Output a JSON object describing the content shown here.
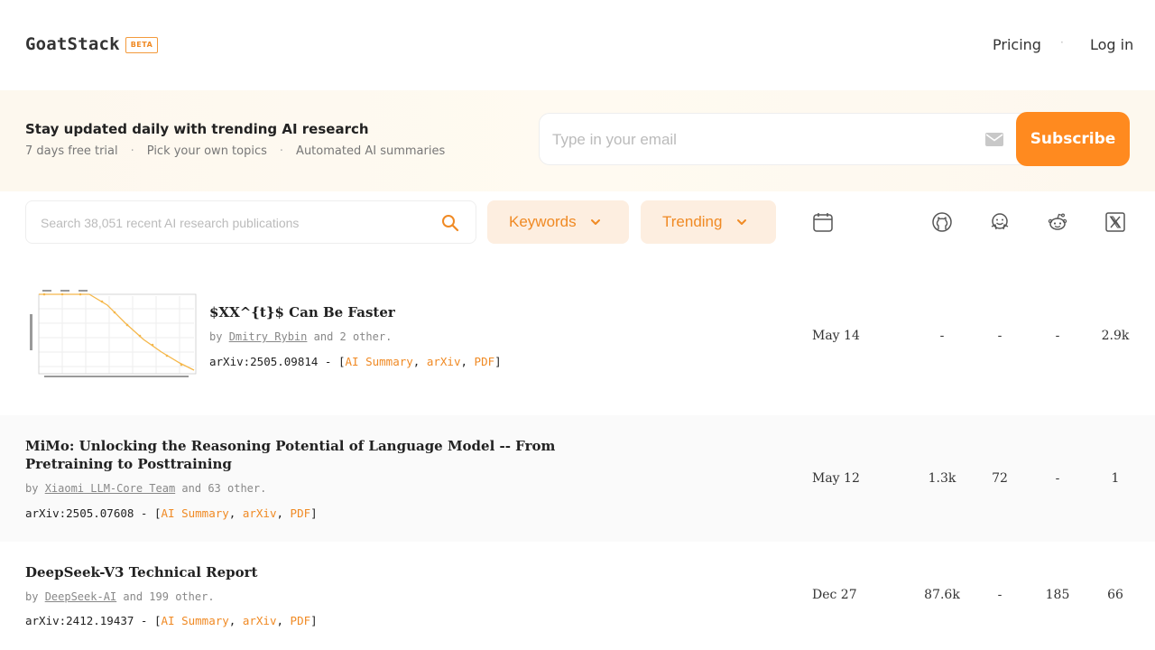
{
  "header": {
    "logo": "GoatStack",
    "badge": "BETA",
    "nav": {
      "pricing": "Pricing",
      "separator": "·",
      "login": "Log in"
    }
  },
  "banner": {
    "title": "Stay updated daily with trending AI research",
    "features": [
      "7 days free trial",
      "Pick your own topics",
      "Automated AI summaries"
    ],
    "separator": "·",
    "email_placeholder": "Type in your email",
    "subscribe_label": "Subscribe"
  },
  "toolbar": {
    "search_placeholder": "Search 38,051 recent AI research publications",
    "keywords_label": "Keywords",
    "trending_label": "Trending",
    "icons": [
      "calendar-icon",
      "github-icon",
      "huggingface-icon",
      "reddit-icon",
      "x-icon"
    ]
  },
  "colors": {
    "accent": "#ff8a1f",
    "accent_soft": "#fdeee0",
    "banner_bg": "#fdf8ee"
  },
  "papers": [
    {
      "title": "$XX^{t}$ Can Be Faster",
      "by_prefix": "by",
      "author": "Dmitry Rybin",
      "others": "and 2 other.",
      "arxiv_prefix": "arXiv:2505.09814 - [",
      "links": [
        "AI Summary",
        "arXiv",
        "PDF"
      ],
      "arxiv_suffix": "]",
      "date": "May 14",
      "github": "-",
      "huggingface": "-",
      "reddit": "-",
      "x": "2.9k"
    },
    {
      "title": "MiMo: Unlocking the Reasoning Potential of Language Model -- From Pretraining to Posttraining",
      "by_prefix": "by",
      "author": "Xiaomi LLM-Core Team",
      "others": "and 63 other.",
      "arxiv_prefix": "arXiv:2505.07608 - [",
      "links": [
        "AI Summary",
        "arXiv",
        "PDF"
      ],
      "arxiv_suffix": "]",
      "date": "May 12",
      "github": "1.3k",
      "huggingface": "72",
      "reddit": "-",
      "x": "1"
    },
    {
      "title": "DeepSeek-V3 Technical Report",
      "by_prefix": "by",
      "author": "DeepSeek-AI",
      "others": "and 199 other.",
      "arxiv_prefix": "arXiv:2412.19437 - [",
      "links": [
        "AI Summary",
        "arXiv",
        "PDF"
      ],
      "arxiv_suffix": "]",
      "date": "Dec 27",
      "github": "87.6k",
      "huggingface": "-",
      "reddit": "185",
      "x": "66"
    }
  ]
}
